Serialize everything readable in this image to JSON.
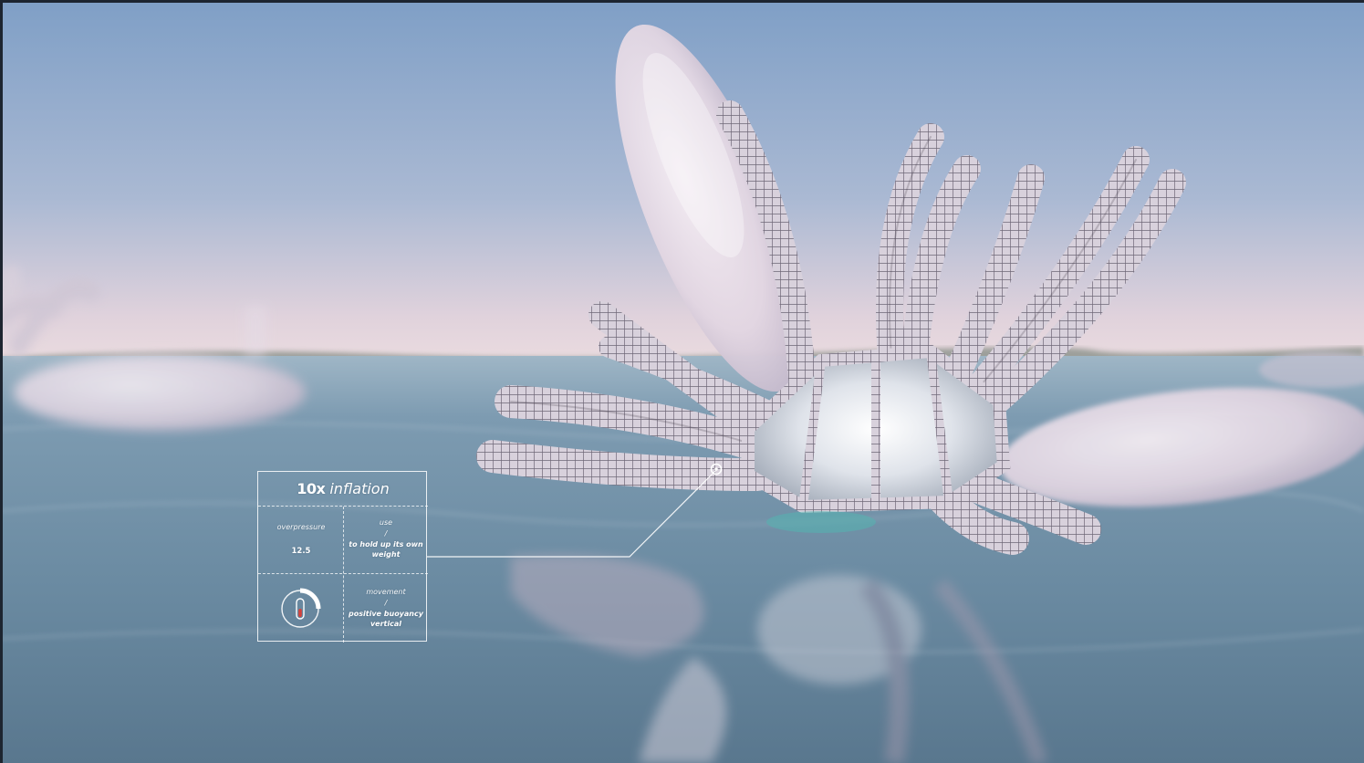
{
  "panel": {
    "title_multiplier": "10x",
    "title_word": "inflation",
    "overpressure_label": "overpressure",
    "overpressure_value": "12.5",
    "use_label": "use",
    "use_separator": "/",
    "use_value": "to hold up its own weight",
    "movement_label": "movement",
    "movement_separator": "/",
    "movement_value_line1": "positive buoyancy",
    "movement_value_line2": "vertical",
    "gauge_level": 0.5
  },
  "colors": {
    "sky_top": "#7f9ec4",
    "sky_horizon": "#e6d3d9",
    "water": "#6a8aa1",
    "panel_line": "#ffffff",
    "gauge_accent": "#d4423b",
    "structure": "#e8e3ea"
  },
  "icons": {
    "gauge": "pressure-gauge-icon",
    "callout_marker": "target-circle-icon"
  }
}
